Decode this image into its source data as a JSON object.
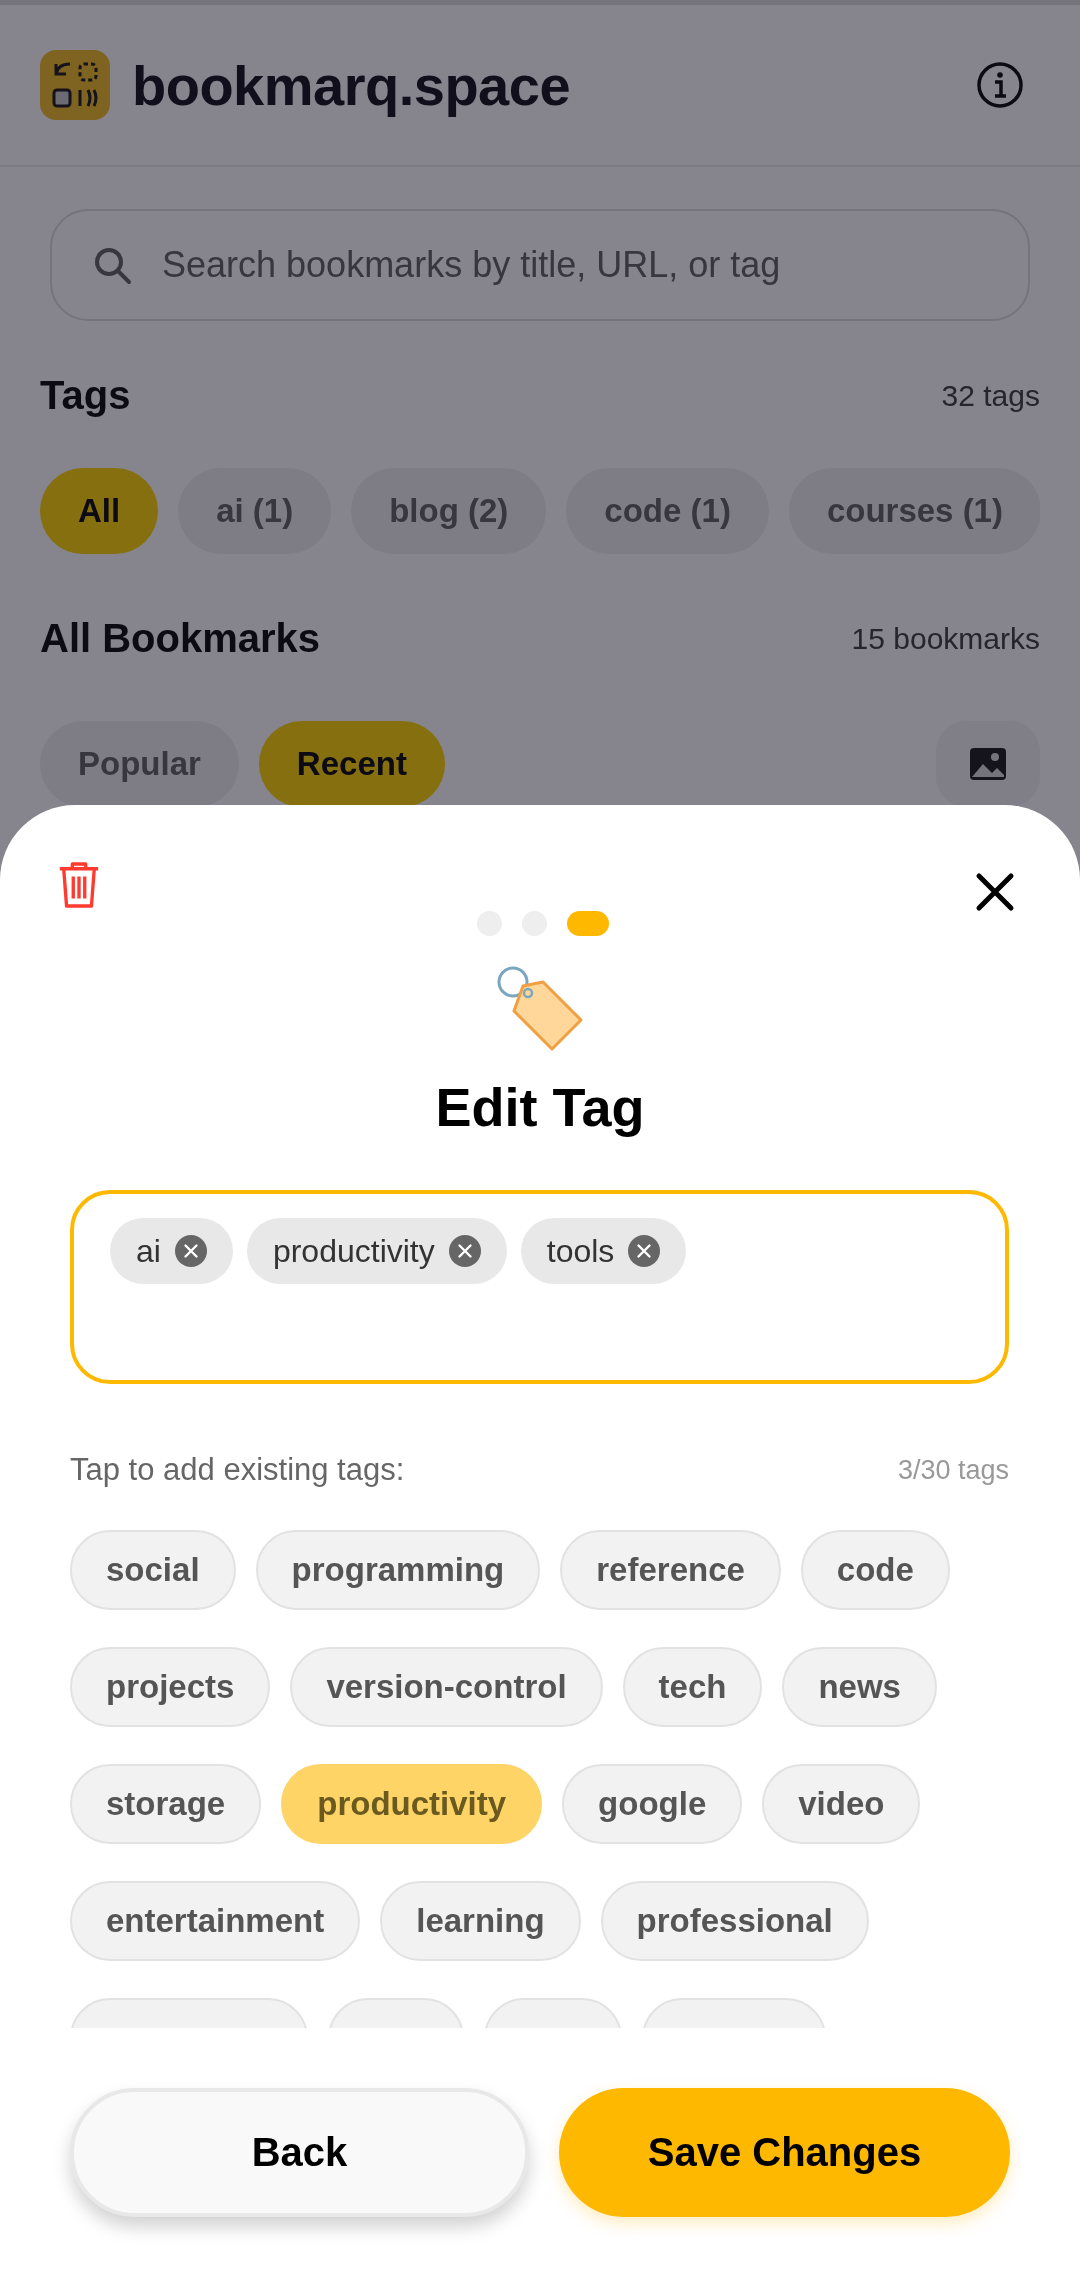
{
  "app_bar": {
    "title": "bookmarq.space"
  },
  "search": {
    "placeholder": "Search bookmarks by title, URL, or tag"
  },
  "tags_section": {
    "title": "Tags",
    "count": "32 tags",
    "filters": [
      {
        "label": "All",
        "selected": true
      },
      {
        "label": "ai (1)",
        "selected": false
      },
      {
        "label": "blog (2)",
        "selected": false
      },
      {
        "label": "code (1)",
        "selected": false
      },
      {
        "label": "courses (1)",
        "selected": false
      }
    ]
  },
  "bookmarks_section": {
    "title": "All Bookmarks",
    "count": "15 bookmarks",
    "sort_tabs": [
      {
        "label": "Popular",
        "selected": false
      },
      {
        "label": "Recent",
        "selected": true
      }
    ]
  },
  "sheet": {
    "steps": [
      {
        "selected": false
      },
      {
        "selected": false
      },
      {
        "selected": true
      }
    ],
    "title": "Edit Tag",
    "selected_tags": [
      {
        "label": "ai"
      },
      {
        "label": "productivity"
      },
      {
        "label": "tools"
      }
    ],
    "suggestions_label": "Tap to add existing tags:",
    "suggestions_count": "3/30 tags",
    "suggestions": [
      {
        "label": "social",
        "selected": false
      },
      {
        "label": "programming",
        "selected": false
      },
      {
        "label": "reference",
        "selected": false
      },
      {
        "label": "code",
        "selected": false
      },
      {
        "label": "projects",
        "selected": false
      },
      {
        "label": "version-control",
        "selected": false
      },
      {
        "label": "tech",
        "selected": false
      },
      {
        "label": "news",
        "selected": false
      },
      {
        "label": "storage",
        "selected": false
      },
      {
        "label": "productivity",
        "selected": true
      },
      {
        "label": "google",
        "selected": false
      },
      {
        "label": "video",
        "selected": false
      },
      {
        "label": "entertainment",
        "selected": false
      },
      {
        "label": "learning",
        "selected": false
      },
      {
        "label": "professional",
        "selected": false
      }
    ],
    "buttons": [
      {
        "label": "Back",
        "kind": "secondary"
      },
      {
        "label": "Save Changes",
        "kind": "primary"
      }
    ]
  }
}
